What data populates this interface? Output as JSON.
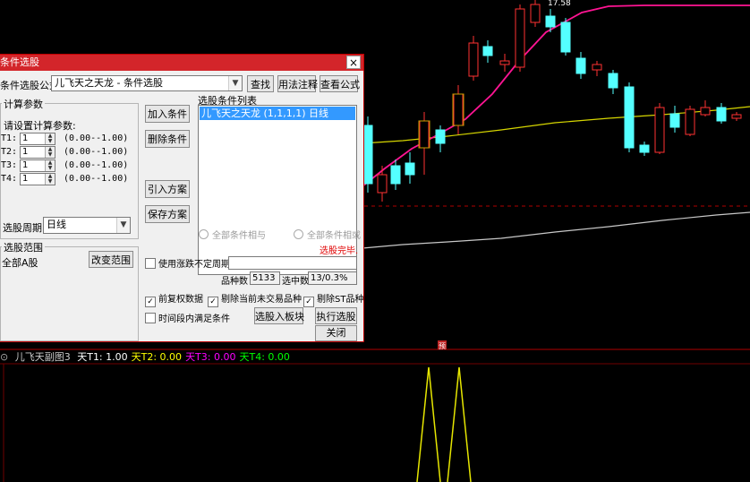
{
  "chart": {
    "price_tag": "17.58",
    "marker_label": "预",
    "sub_indicator": {
      "name": "儿飞天副图3",
      "params": [
        {
          "text": "天T1: 1.00",
          "color": "#ffffff"
        },
        {
          "text": "天T2: 0.00",
          "color": "#ffff00"
        },
        {
          "text": "天T3: 0.00",
          "color": "#ff00ff"
        },
        {
          "text": "天T4: 0.00",
          "color": "#00ff00"
        }
      ]
    },
    "colors": {
      "up": "#ff3232",
      "down": "#54ffff",
      "ma_pink": "#ff1493",
      "ma_yellow": "#d6d600",
      "ma_white": "#c8c8c8"
    }
  },
  "dialog": {
    "title": "条件选股",
    "formula_label": "条件选股公式",
    "formula_value": "儿飞天之天龙 - 条件选股",
    "btn_find": "查找",
    "btn_usage": "用法注释",
    "btn_view": "查看公式",
    "calc_group": "计算参数",
    "calc_prompt": "请设置计算参数:",
    "params": [
      {
        "name": "T1:",
        "value": "1",
        "range": "(0.00--1.00)"
      },
      {
        "name": "T2:",
        "value": "1",
        "range": "(0.00--1.00)"
      },
      {
        "name": "T3:",
        "value": "1",
        "range": "(0.00--1.00)"
      },
      {
        "name": "T4:",
        "value": "1",
        "range": "(0.00--1.00)"
      }
    ],
    "period_label": "选股周期:",
    "period_value": "日线",
    "btn_add": "加入条件",
    "btn_delete": "删除条件",
    "btn_import": "引入方案",
    "btn_save": "保存方案",
    "cond_list_label": "选股条件列表",
    "cond_items": [
      "儿飞天之天龙 (1,1,1,1) 日线"
    ],
    "radio_and": "全部条件相与",
    "radio_or": "全部条件相或",
    "status": "选股完毕.",
    "range_group": "选股范围",
    "range_value": "全部A股",
    "btn_change_range": "改变范围",
    "chk_uncertain": "使用涨跌不定周期",
    "stock_count_label": "品种数",
    "stock_count": "5133",
    "selected_label": "选中数",
    "selected_value": "13/0.3%",
    "chk_fq": "前复权数据",
    "chk_exclude_nontrade": "剔除当前未交易品种",
    "chk_exclude_st": "剔除ST品种",
    "chk_time": "时间段内满足条件",
    "btn_to_block": "选股入板块",
    "btn_execute": "执行选股",
    "btn_close": "关闭"
  }
}
